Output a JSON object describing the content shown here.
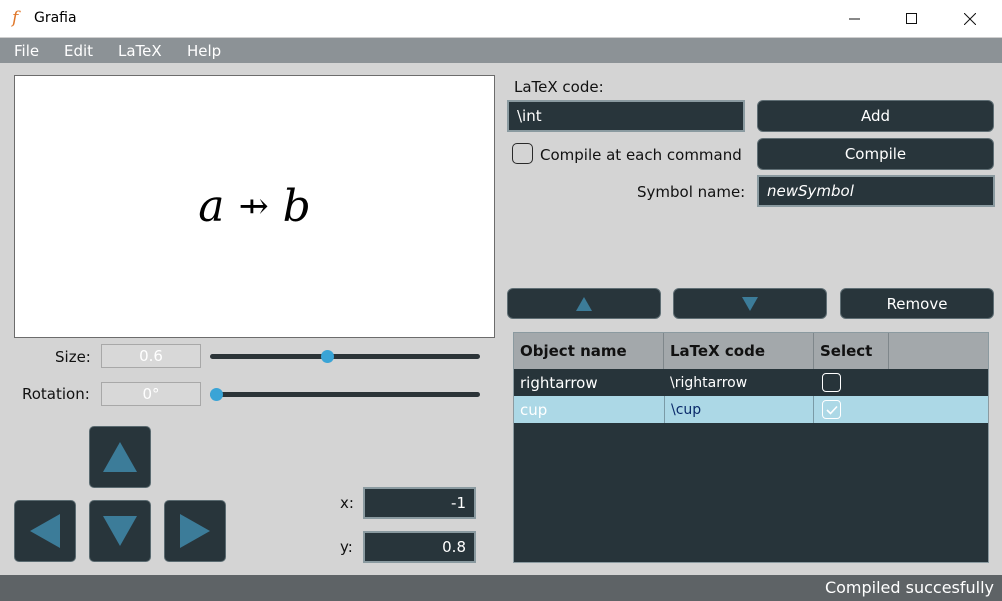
{
  "window": {
    "title": "Grafia",
    "app_icon_glyph": "𝑓"
  },
  "menu": [
    "File",
    "Edit",
    "LaTeX",
    "Help"
  ],
  "preview": {
    "left": "a",
    "operator": "⇸",
    "right": "b"
  },
  "size": {
    "label": "Size:",
    "value": "0.6",
    "slider_fraction": 0.43
  },
  "rotation": {
    "label": "Rotation:",
    "value": "0°",
    "slider_fraction": 0.0
  },
  "position": {
    "x_label": "x:",
    "x_value": "-1",
    "y_label": "y:",
    "y_value": "0.8"
  },
  "latex": {
    "code_label": "LaTeX code:",
    "code_value": "\\int",
    "add_label": "Add",
    "compile_each_label": "Compile at each command",
    "compile_each_checked": false,
    "compile_label": "Compile",
    "symbol_name_label": "Symbol name:",
    "symbol_name_value": "newSymbol"
  },
  "list_controls": {
    "up_icon": "triangle-up-icon",
    "down_icon": "triangle-down-icon",
    "remove_label": "Remove"
  },
  "table": {
    "headers": [
      "Object name",
      "LaTeX code",
      "Select"
    ],
    "rows": [
      {
        "name": "rightarrow",
        "code": "\\rightarrow",
        "selected": false
      },
      {
        "name": "cup",
        "code": "\\cup",
        "selected": true
      }
    ]
  },
  "status": "Compiled succesfully",
  "colors": {
    "accent": "#3aa4d6",
    "dark_panel": "#28353b",
    "selected_row": "#acd8e6"
  }
}
